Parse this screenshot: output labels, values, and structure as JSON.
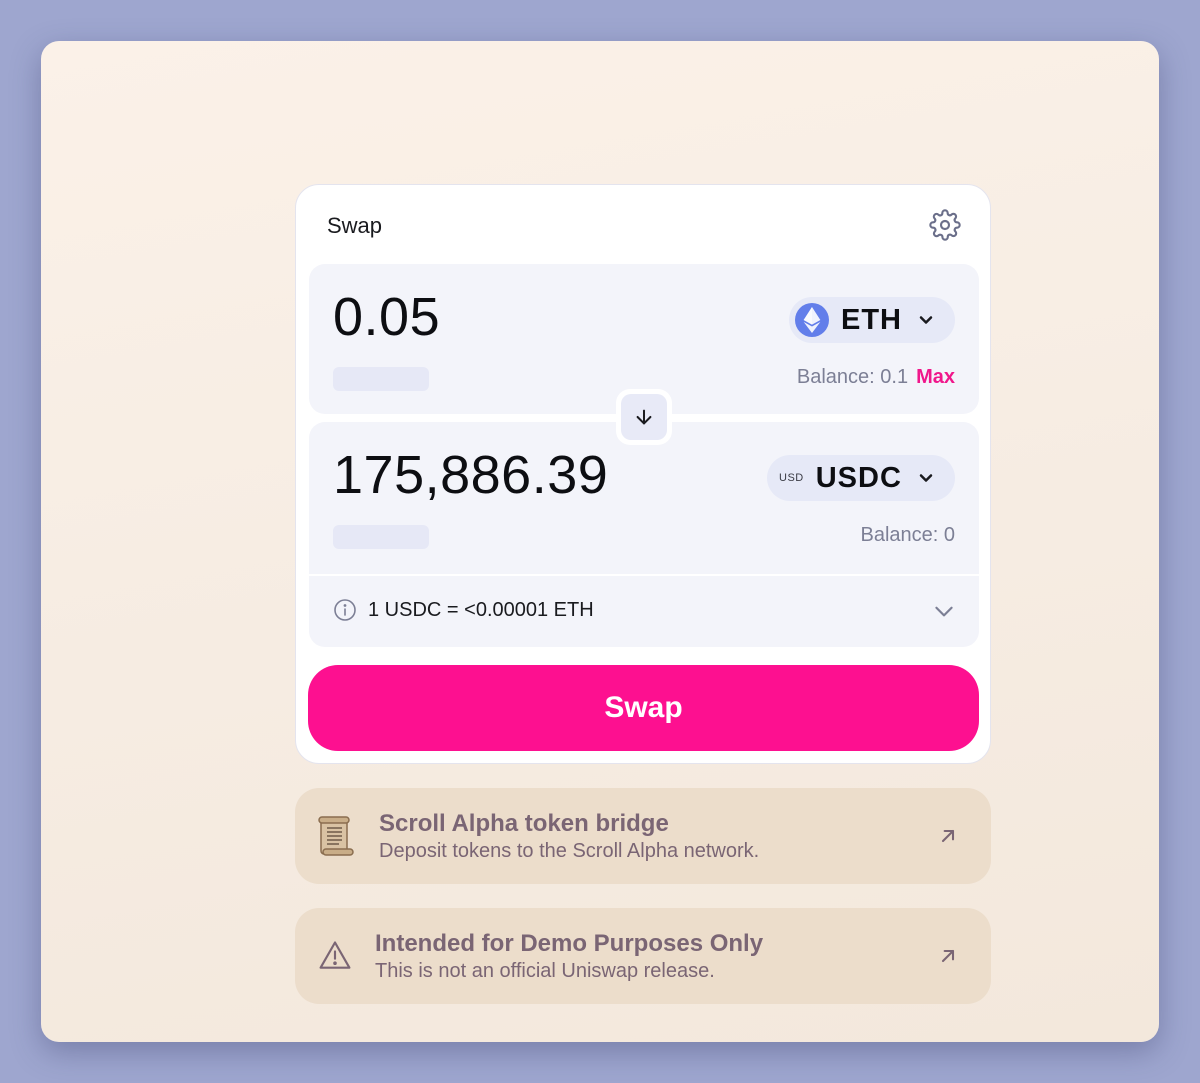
{
  "swap": {
    "title": "Swap",
    "input": {
      "amount": "0.05",
      "token": "ETH",
      "balance_label": "Balance: 0.1",
      "max_label": "Max"
    },
    "output": {
      "amount": "175,886.39",
      "token": "USDC",
      "token_tag": "USD",
      "balance_label": "Balance: 0"
    },
    "rate": "1 USDC = <0.00001 ETH",
    "button_label": "Swap"
  },
  "banners": [
    {
      "title": "Scroll Alpha token bridge",
      "subtitle": "Deposit tokens to the Scroll Alpha network.",
      "icon": "scroll-icon"
    },
    {
      "title": "Intended for Demo Purposes Only",
      "subtitle": "This is not an official Uniswap release.",
      "icon": "warning-icon"
    }
  ],
  "icons": {
    "settings": "gear-icon",
    "switch": "arrow-down-icon",
    "info": "info-icon",
    "dropdown": "chevron-down-icon",
    "external": "arrow-up-right-icon"
  },
  "colors": {
    "accent": "#fd1090",
    "eth_blue": "#627eea",
    "panel_bg": "#f3f4fa",
    "banner_bg": "#ecddcb"
  }
}
